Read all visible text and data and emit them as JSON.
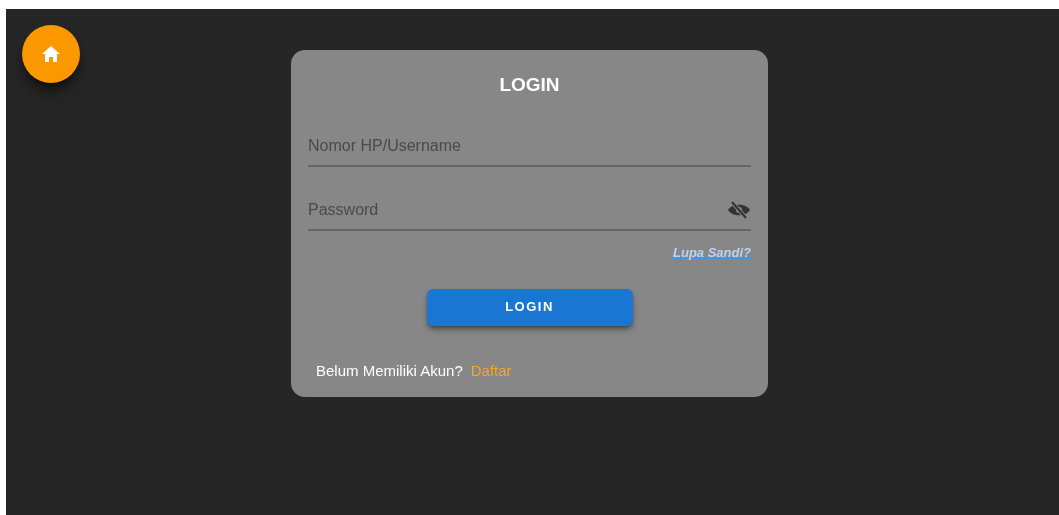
{
  "home_button": {
    "kind": "home"
  },
  "login_card": {
    "title": "LOGIN",
    "fields": [
      {
        "kind": "text",
        "placeholder": "Nomor HP/Username"
      },
      {
        "kind": "password",
        "placeholder": "Password",
        "obscured": true
      }
    ],
    "forgot_link": "Lupa Sandi?",
    "login_button": "LOGIN",
    "signup_prompt": "Belum Memiliki Akun?",
    "signup_link": "Daftar"
  }
}
